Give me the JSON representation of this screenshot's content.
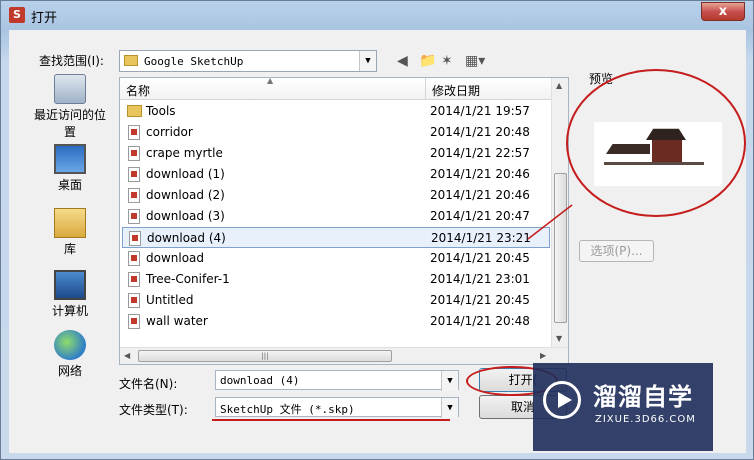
{
  "window": {
    "title": "打开",
    "close_label": "x"
  },
  "toolbar": {
    "lookin_label": "查找范围(I):",
    "lookin_value": "Google SketchUp",
    "back_icon": "back-arrow-icon",
    "up_icon": "up-folder-icon",
    "newfolder_icon": "new-folder-icon",
    "views_icon": "view-menu-icon"
  },
  "places": [
    {
      "label": "最近访问的位置",
      "icon": "recent-places-icon"
    },
    {
      "label": "桌面",
      "icon": "desktop-icon"
    },
    {
      "label": "库",
      "icon": "libraries-icon"
    },
    {
      "label": "计算机",
      "icon": "computer-icon"
    },
    {
      "label": "网络",
      "icon": "network-icon"
    }
  ],
  "list": {
    "columns": [
      "名称",
      "修改日期"
    ],
    "rows": [
      {
        "name": "Tools",
        "date": "2014/1/21 19:57",
        "type": "folder"
      },
      {
        "name": "corridor",
        "date": "2014/1/21 20:48",
        "type": "file"
      },
      {
        "name": "crape myrtle",
        "date": "2014/1/21 22:57",
        "type": "file"
      },
      {
        "name": "download (1)",
        "date": "2014/1/21 20:46",
        "type": "file"
      },
      {
        "name": "download (2)",
        "date": "2014/1/21 20:46",
        "type": "file"
      },
      {
        "name": "download (3)",
        "date": "2014/1/21 20:47",
        "type": "file"
      },
      {
        "name": "download (4)",
        "date": "2014/1/21 23:21",
        "type": "file",
        "selected": true
      },
      {
        "name": "download",
        "date": "2014/1/21 20:45",
        "type": "file"
      },
      {
        "name": "Tree-Conifer-1",
        "date": "2014/1/21 23:01",
        "type": "file"
      },
      {
        "name": "Untitled",
        "date": "2014/1/21 20:45",
        "type": "file"
      },
      {
        "name": "wall water",
        "date": "2014/1/21 20:48",
        "type": "file"
      }
    ]
  },
  "preview": {
    "label": "预览",
    "options_label": "选项(P)..."
  },
  "footer": {
    "filename_label": "文件名(N):",
    "filename_value": "download (4)",
    "filetype_label": "文件类型(T):",
    "filetype_value": "SketchUp 文件 (*.skp)",
    "open_label": "打开(",
    "cancel_label": "取消"
  },
  "watermark": {
    "title": "溜溜自学",
    "subtitle": "ZIXUE.3D66.COM"
  },
  "colors": {
    "annotation": "#c51c1c",
    "selection": "#e8f0fb",
    "title_bar": "#b9d1ea"
  }
}
